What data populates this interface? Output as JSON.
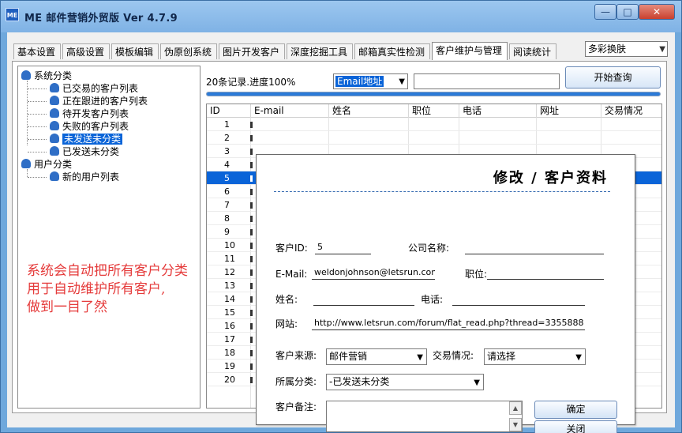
{
  "window": {
    "title": "ME 邮件营销外贸版 Ver 4.7.9",
    "icon_text": "ME",
    "controls": {
      "min": "—",
      "max": "□",
      "close": "✕"
    }
  },
  "tabs": [
    {
      "label": "基本设置"
    },
    {
      "label": "高级设置"
    },
    {
      "label": "模板编辑"
    },
    {
      "label": "伪原创系统"
    },
    {
      "label": "图片开发客户"
    },
    {
      "label": "深度挖掘工具"
    },
    {
      "label": "邮箱真实性检测"
    },
    {
      "label": "客户维护与管理",
      "active": true
    },
    {
      "label": "阅读统计"
    }
  ],
  "skin_select": {
    "value": "多彩换肤"
  },
  "tree": {
    "root1": "系统分类",
    "children1": [
      "已交易的客户列表",
      "正在跟进的客户列表",
      "待开发客户列表",
      "失败的客户列表",
      "未发送未分类",
      "已发送未分类"
    ],
    "selected_index": 4,
    "root2": "用户分类",
    "children2": [
      "新的用户列表"
    ]
  },
  "annotation": {
    "lines": [
      "系统会自动把所有客户分类",
      "用于自动维护所有客户,",
      "做到一目了然"
    ],
    "color": "#e53b3b"
  },
  "search": {
    "status": "20条记录.进度100%",
    "field": "Email地址",
    "query": "",
    "button": "开始查询",
    "progress": 1.0
  },
  "grid": {
    "headers": [
      "ID",
      "E-mail",
      "姓名",
      "职位",
      "电话",
      "网址",
      "交易情况"
    ],
    "ids": [
      "1",
      "2",
      "3",
      "4",
      "5",
      "6",
      "7",
      "8",
      "9",
      "10",
      "11",
      "12",
      "13",
      "14",
      "15",
      "16",
      "17",
      "18",
      "19",
      "20"
    ],
    "selected_id": "5"
  },
  "dialog": {
    "title": "修改 / 客户资料",
    "labels": {
      "id": "客户ID:",
      "company": "公司名称:",
      "email": "E-Mail:",
      "position": "职位:",
      "name": "姓名:",
      "phone": "电话:",
      "website": "网站:",
      "source": "客户来源:",
      "trade": "交易情况:",
      "category": "所属分类:",
      "remark": "客户备注:"
    },
    "values": {
      "id": "5",
      "company": "",
      "email": "weldonjohnson@letsrun.com",
      "position": "",
      "name": "",
      "phone": "",
      "website": "http://www.letsrun.com/forum/flat_read.php?thread=3355888",
      "source": "邮件营销",
      "trade": "请选择",
      "category": "-已发送未分类",
      "remark": ""
    },
    "buttons": {
      "ok": "确定",
      "close": "关闭"
    }
  }
}
